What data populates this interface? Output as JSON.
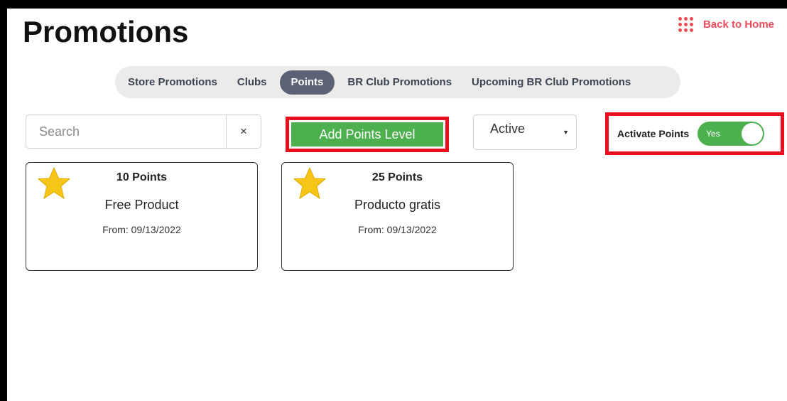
{
  "header": {
    "title": "Promotions",
    "back_label": "Back to Home"
  },
  "tabs": [
    {
      "label": "Store Promotions",
      "active": false
    },
    {
      "label": "Clubs",
      "active": false
    },
    {
      "label": "Points",
      "active": true
    },
    {
      "label": "BR Club Promotions",
      "active": false
    },
    {
      "label": "Upcoming BR Club Promotions",
      "active": false
    }
  ],
  "toolbar": {
    "search_placeholder": "Search",
    "search_value": "",
    "clear_label": "×",
    "add_label": "Add Points Level",
    "status_select": "Active",
    "activate_label": "Activate Points",
    "toggle_label": "Yes",
    "toggle_on": true
  },
  "cards": [
    {
      "points": "10 Points",
      "name": "Free Product",
      "date": "From: 09/13/2022"
    },
    {
      "points": "25 Points",
      "name": "Producto gratis",
      "date": "From: 09/13/2022"
    }
  ],
  "colors": {
    "accent_red": "#ef4b59",
    "highlight_red": "#e8101f",
    "green": "#4db04f",
    "tab_active_bg": "#5a6274",
    "star_gold": "#f5c518"
  },
  "icons": {
    "back": "grid-dots-icon",
    "clear": "close-icon",
    "select": "caret-down-icon",
    "card": "star-icon"
  }
}
